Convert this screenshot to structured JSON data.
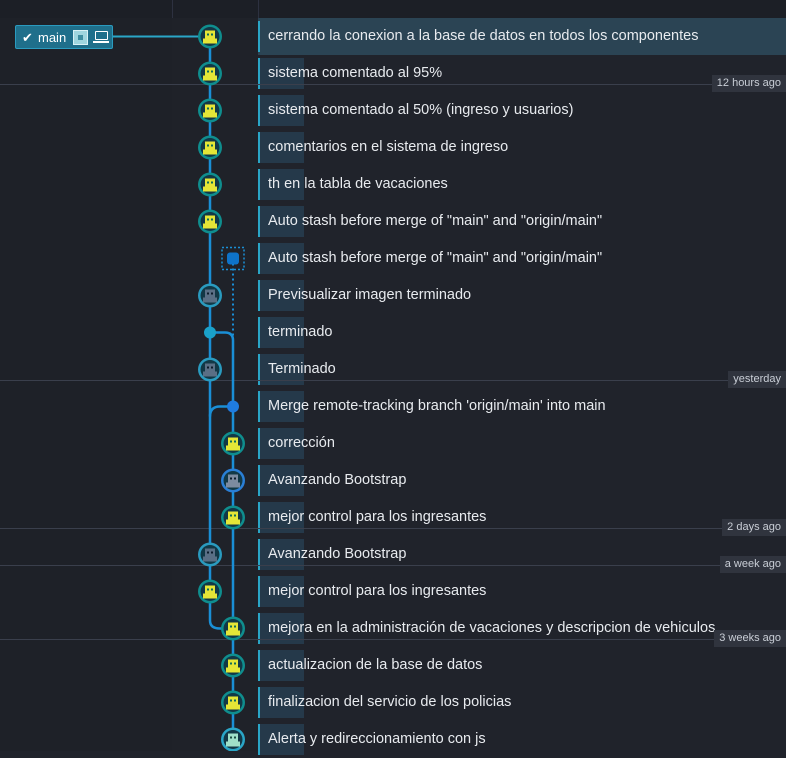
{
  "branch": {
    "name": "main",
    "check_icon": "check-icon",
    "avatar_icon": "avatar-icon",
    "local_icon": "laptop-icon"
  },
  "colors": {
    "accent": "#2aa6c7",
    "graph_line": "#1a8fd6",
    "selected_row": "#2b4454",
    "avatar_yellow": "#e5e637",
    "avatar_dark": "#2c3e50"
  },
  "commits": [
    {
      "message": "cerrando la conexion a la base de datos en todos los componentes",
      "lane": 0,
      "avatar": "yellow",
      "selected": true
    },
    {
      "message": "sistema comentado al 95%",
      "lane": 0,
      "avatar": "yellow"
    },
    {
      "message": "sistema comentado al 50% (ingreso y usuarios)",
      "lane": 0,
      "avatar": "yellow"
    },
    {
      "message": "comentarios en el sistema de ingreso",
      "lane": 0,
      "avatar": "yellow"
    },
    {
      "message": "th en la tabla de vacaciones",
      "lane": 0,
      "avatar": "yellow"
    },
    {
      "message": "Auto stash before merge of \"main\" and \"origin/main\"",
      "lane": 0,
      "avatar": "yellow"
    },
    {
      "message": "Auto stash before merge of \"main\" and \"origin/main\"",
      "lane": 1,
      "avatar": "stash"
    },
    {
      "message": "Previsualizar imagen terminado",
      "lane": 0,
      "avatar": "dark"
    },
    {
      "message": "terminado",
      "lane": 0,
      "avatar": "dot"
    },
    {
      "message": "Terminado",
      "lane": 0,
      "avatar": "dark"
    },
    {
      "message": "Merge remote-tracking branch 'origin/main' into main",
      "lane": 1,
      "avatar": "dot-blue"
    },
    {
      "message": "corrección",
      "lane": 1,
      "avatar": "yellow"
    },
    {
      "message": "Avanzando Bootstrap",
      "lane": 1,
      "avatar": "blue"
    },
    {
      "message": "mejor control para los ingresantes",
      "lane": 1,
      "avatar": "yellow"
    },
    {
      "message": "Avanzando Bootstrap",
      "lane": 0,
      "avatar": "dark"
    },
    {
      "message": "mejor control para los ingresantes",
      "lane": 0,
      "avatar": "yellow"
    },
    {
      "message": "mejora en la administración de vacaciones y descripcion de vehiculos",
      "lane": 1,
      "avatar": "yellow"
    },
    {
      "message": "actualizacion de la base de datos",
      "lane": 1,
      "avatar": "yellow"
    },
    {
      "message": "finalizacion del servicio de los policias",
      "lane": 1,
      "avatar": "yellow"
    },
    {
      "message": "Alerta y redireccionamiento con js",
      "lane": 1,
      "avatar": "green"
    }
  ],
  "time_markers": [
    {
      "label": "12 hours ago",
      "row": 2
    },
    {
      "label": "yesterday",
      "row": 10
    },
    {
      "label": "2 days ago",
      "row": 14
    },
    {
      "label": "a week ago",
      "row": 15
    },
    {
      "label": "3 weeks ago",
      "row": 17
    }
  ]
}
